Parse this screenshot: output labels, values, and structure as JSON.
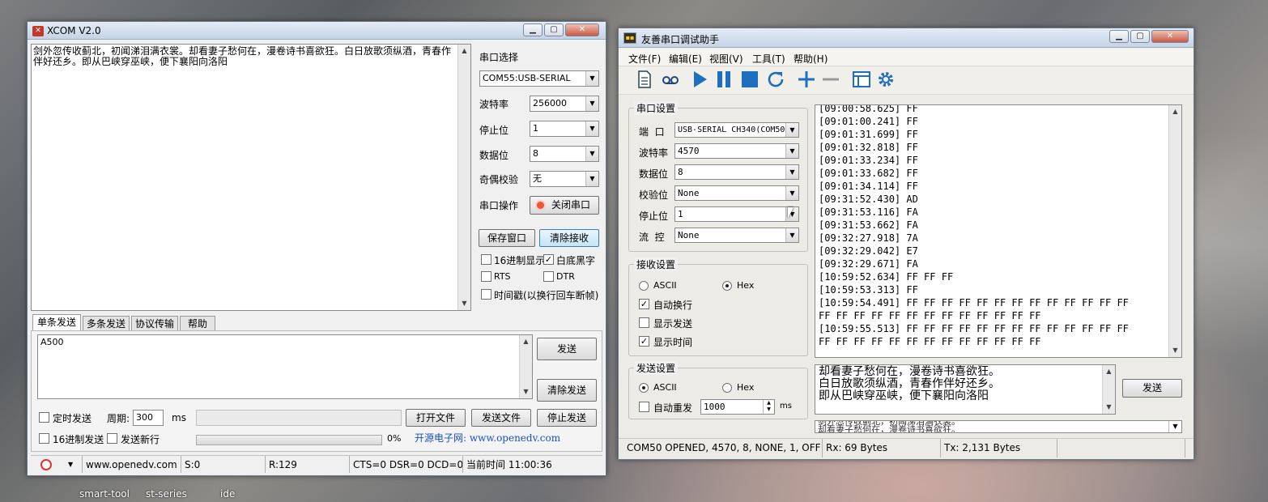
{
  "desktop": {
    "taskbar": [
      {
        "label": "smart-tool"
      },
      {
        "label": "st-series"
      },
      {
        "label": "ide"
      }
    ]
  },
  "xcom": {
    "title": "XCOM V2.0",
    "receive_text": "剑外忽传收蓟北，初闻涕泪满衣裳。却看妻子愁何在，漫卷诗书喜欲狂。白日放歌须纵酒，青春作伴好还乡。即从巴峡穿巫峡，便下襄阳向洛阳",
    "port_select_label": "串口选择",
    "port_value": "COM55:USB-SERIAL",
    "baud_label": "波特率",
    "baud_value": "256000",
    "stop_label": "停止位",
    "stop_value": "1",
    "data_label": "数据位",
    "data_value": "8",
    "parity_label": "奇偶校验",
    "parity_value": "无",
    "op_label": "串口操作",
    "close_port": "关闭串口",
    "save_window": "保存窗口",
    "clear_recv": "清除接收",
    "hex_display": "16进制显示",
    "white_bg": "白底黑字",
    "rts": "RTS",
    "dtr": "DTR",
    "timestamp": "时间戳(以换行回车断帧)",
    "tabs": [
      {
        "label": "单条发送"
      },
      {
        "label": "多条发送"
      },
      {
        "label": "协议传输"
      },
      {
        "label": "帮助"
      }
    ],
    "send_text": "A500",
    "send": "发送",
    "clear_send": "清除发送",
    "timed_send": "定时发送",
    "period_label": "周期:",
    "period_value": "300",
    "ms": "ms",
    "open_file": "打开文件",
    "send_file": "发送文件",
    "stop_send": "停止发送",
    "hex_send": "16进制发送",
    "send_newline": "发送新行",
    "percent": "0%",
    "site_banner": "开源电子网: www.openedv.com",
    "status": {
      "site": "www.openedv.com",
      "s": "S:0",
      "r": "R:129",
      "lines": "CTS=0 DSR=0 DCD=0",
      "time": "当前时间 11:00:36"
    }
  },
  "youshan": {
    "title": "友善串口调试助手",
    "menu": [
      {
        "label": "文件(F)"
      },
      {
        "label": "编辑(E)"
      },
      {
        "label": "视图(V)"
      },
      {
        "label": "工具(T)"
      },
      {
        "label": "帮助(H)"
      }
    ],
    "serial_group": "串口设置",
    "port_label": "端  口",
    "port_value": "USB-SERIAL CH340(COM50",
    "baud_label": "波特率",
    "baud_value": "4570",
    "data_label": "数据位",
    "data_value": "8",
    "parity_label": "校验位",
    "parity_value": "None",
    "stop_label": "停止位",
    "stop_value": "1",
    "flow_label": "流  控",
    "flow_value": "None",
    "recv_group": "接收设置",
    "ascii": "ASCII",
    "hex": "Hex",
    "auto_wrap": "自动换行",
    "show_send": "显示发送",
    "show_time": "显示时间",
    "send_group": "发送设置",
    "auto_resend": "自动重发",
    "resend_value": "1000",
    "ms": "ms",
    "send": "发送",
    "recv_lines": [
      "[09:00:58.625] FF",
      "[09:01:00.241] FF",
      "[09:01:31.699] FF",
      "[09:01:32.818] FF",
      "[09:01:33.234] FF",
      "[09:01:33.682] FF",
      "[09:01:34.114] FF",
      "[09:31:52.430] AD",
      "[09:31:53.116] FA",
      "[09:31:53.662] FA",
      "[09:32:27.918] 7A",
      "[09:32:29.042] E7",
      "[09:32:29.671] FA",
      "[10:59:52.634] FF FF FF",
      "[10:59:53.313] FF",
      "[10:59:54.491] FF FF FF FF FF FF FF FF FF FF FF FF FF",
      "FF FF FF FF FF FF FF FF FF FF FF FF FF",
      "[10:59:55.513] FF FF FF FF FF FF FF FF FF FF FF FF FF",
      "FF FF FF FF FF FF FF FF FF FF FF FF FF"
    ],
    "send_lines": [
      "却看妻子愁何在，漫卷诗书喜欲狂。",
      "白日放歌须纵酒，青春作伴好还乡。",
      "即从巴峡穿巫峡，便下襄阳向洛阳"
    ],
    "history_lines": [
      "剑外忽传收蓟北，初闻涕泪满衣裳。",
      "却看妻子愁何在，漫卷诗书喜欲狂。"
    ],
    "status": {
      "conn": "COM50 OPENED, 4570, 8, NONE, 1, OFF",
      "rx": "Rx: 69 Bytes",
      "tx": "Tx: 2,131 Bytes"
    }
  }
}
